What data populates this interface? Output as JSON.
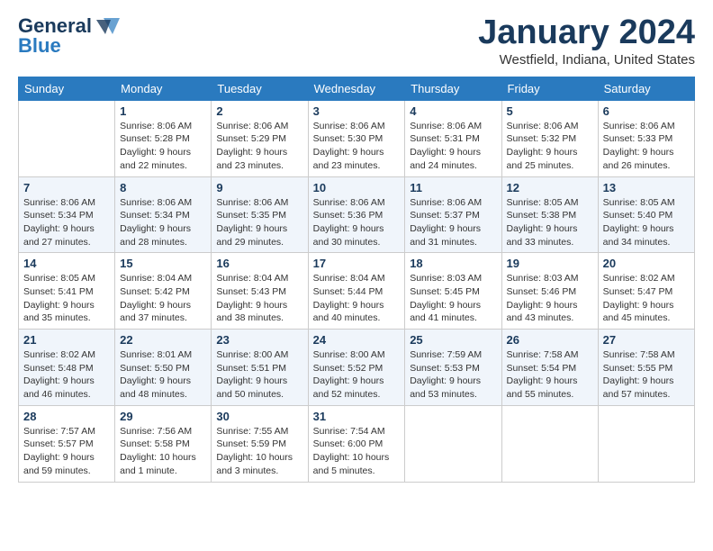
{
  "header": {
    "logo_general": "General",
    "logo_blue": "Blue",
    "month_title": "January 2024",
    "location": "Westfield, Indiana, United States"
  },
  "days_of_week": [
    "Sunday",
    "Monday",
    "Tuesday",
    "Wednesday",
    "Thursday",
    "Friday",
    "Saturday"
  ],
  "weeks": [
    [
      {
        "num": "",
        "info": ""
      },
      {
        "num": "1",
        "info": "Sunrise: 8:06 AM\nSunset: 5:28 PM\nDaylight: 9 hours\nand 22 minutes."
      },
      {
        "num": "2",
        "info": "Sunrise: 8:06 AM\nSunset: 5:29 PM\nDaylight: 9 hours\nand 23 minutes."
      },
      {
        "num": "3",
        "info": "Sunrise: 8:06 AM\nSunset: 5:30 PM\nDaylight: 9 hours\nand 23 minutes."
      },
      {
        "num": "4",
        "info": "Sunrise: 8:06 AM\nSunset: 5:31 PM\nDaylight: 9 hours\nand 24 minutes."
      },
      {
        "num": "5",
        "info": "Sunrise: 8:06 AM\nSunset: 5:32 PM\nDaylight: 9 hours\nand 25 minutes."
      },
      {
        "num": "6",
        "info": "Sunrise: 8:06 AM\nSunset: 5:33 PM\nDaylight: 9 hours\nand 26 minutes."
      }
    ],
    [
      {
        "num": "7",
        "info": "Sunrise: 8:06 AM\nSunset: 5:34 PM\nDaylight: 9 hours\nand 27 minutes."
      },
      {
        "num": "8",
        "info": "Sunrise: 8:06 AM\nSunset: 5:34 PM\nDaylight: 9 hours\nand 28 minutes."
      },
      {
        "num": "9",
        "info": "Sunrise: 8:06 AM\nSunset: 5:35 PM\nDaylight: 9 hours\nand 29 minutes."
      },
      {
        "num": "10",
        "info": "Sunrise: 8:06 AM\nSunset: 5:36 PM\nDaylight: 9 hours\nand 30 minutes."
      },
      {
        "num": "11",
        "info": "Sunrise: 8:06 AM\nSunset: 5:37 PM\nDaylight: 9 hours\nand 31 minutes."
      },
      {
        "num": "12",
        "info": "Sunrise: 8:05 AM\nSunset: 5:38 PM\nDaylight: 9 hours\nand 33 minutes."
      },
      {
        "num": "13",
        "info": "Sunrise: 8:05 AM\nSunset: 5:40 PM\nDaylight: 9 hours\nand 34 minutes."
      }
    ],
    [
      {
        "num": "14",
        "info": "Sunrise: 8:05 AM\nSunset: 5:41 PM\nDaylight: 9 hours\nand 35 minutes."
      },
      {
        "num": "15",
        "info": "Sunrise: 8:04 AM\nSunset: 5:42 PM\nDaylight: 9 hours\nand 37 minutes."
      },
      {
        "num": "16",
        "info": "Sunrise: 8:04 AM\nSunset: 5:43 PM\nDaylight: 9 hours\nand 38 minutes."
      },
      {
        "num": "17",
        "info": "Sunrise: 8:04 AM\nSunset: 5:44 PM\nDaylight: 9 hours\nand 40 minutes."
      },
      {
        "num": "18",
        "info": "Sunrise: 8:03 AM\nSunset: 5:45 PM\nDaylight: 9 hours\nand 41 minutes."
      },
      {
        "num": "19",
        "info": "Sunrise: 8:03 AM\nSunset: 5:46 PM\nDaylight: 9 hours\nand 43 minutes."
      },
      {
        "num": "20",
        "info": "Sunrise: 8:02 AM\nSunset: 5:47 PM\nDaylight: 9 hours\nand 45 minutes."
      }
    ],
    [
      {
        "num": "21",
        "info": "Sunrise: 8:02 AM\nSunset: 5:48 PM\nDaylight: 9 hours\nand 46 minutes."
      },
      {
        "num": "22",
        "info": "Sunrise: 8:01 AM\nSunset: 5:50 PM\nDaylight: 9 hours\nand 48 minutes."
      },
      {
        "num": "23",
        "info": "Sunrise: 8:00 AM\nSunset: 5:51 PM\nDaylight: 9 hours\nand 50 minutes."
      },
      {
        "num": "24",
        "info": "Sunrise: 8:00 AM\nSunset: 5:52 PM\nDaylight: 9 hours\nand 52 minutes."
      },
      {
        "num": "25",
        "info": "Sunrise: 7:59 AM\nSunset: 5:53 PM\nDaylight: 9 hours\nand 53 minutes."
      },
      {
        "num": "26",
        "info": "Sunrise: 7:58 AM\nSunset: 5:54 PM\nDaylight: 9 hours\nand 55 minutes."
      },
      {
        "num": "27",
        "info": "Sunrise: 7:58 AM\nSunset: 5:55 PM\nDaylight: 9 hours\nand 57 minutes."
      }
    ],
    [
      {
        "num": "28",
        "info": "Sunrise: 7:57 AM\nSunset: 5:57 PM\nDaylight: 9 hours\nand 59 minutes."
      },
      {
        "num": "29",
        "info": "Sunrise: 7:56 AM\nSunset: 5:58 PM\nDaylight: 10 hours\nand 1 minute."
      },
      {
        "num": "30",
        "info": "Sunrise: 7:55 AM\nSunset: 5:59 PM\nDaylight: 10 hours\nand 3 minutes."
      },
      {
        "num": "31",
        "info": "Sunrise: 7:54 AM\nSunset: 6:00 PM\nDaylight: 10 hours\nand 5 minutes."
      },
      {
        "num": "",
        "info": ""
      },
      {
        "num": "",
        "info": ""
      },
      {
        "num": "",
        "info": ""
      }
    ]
  ]
}
